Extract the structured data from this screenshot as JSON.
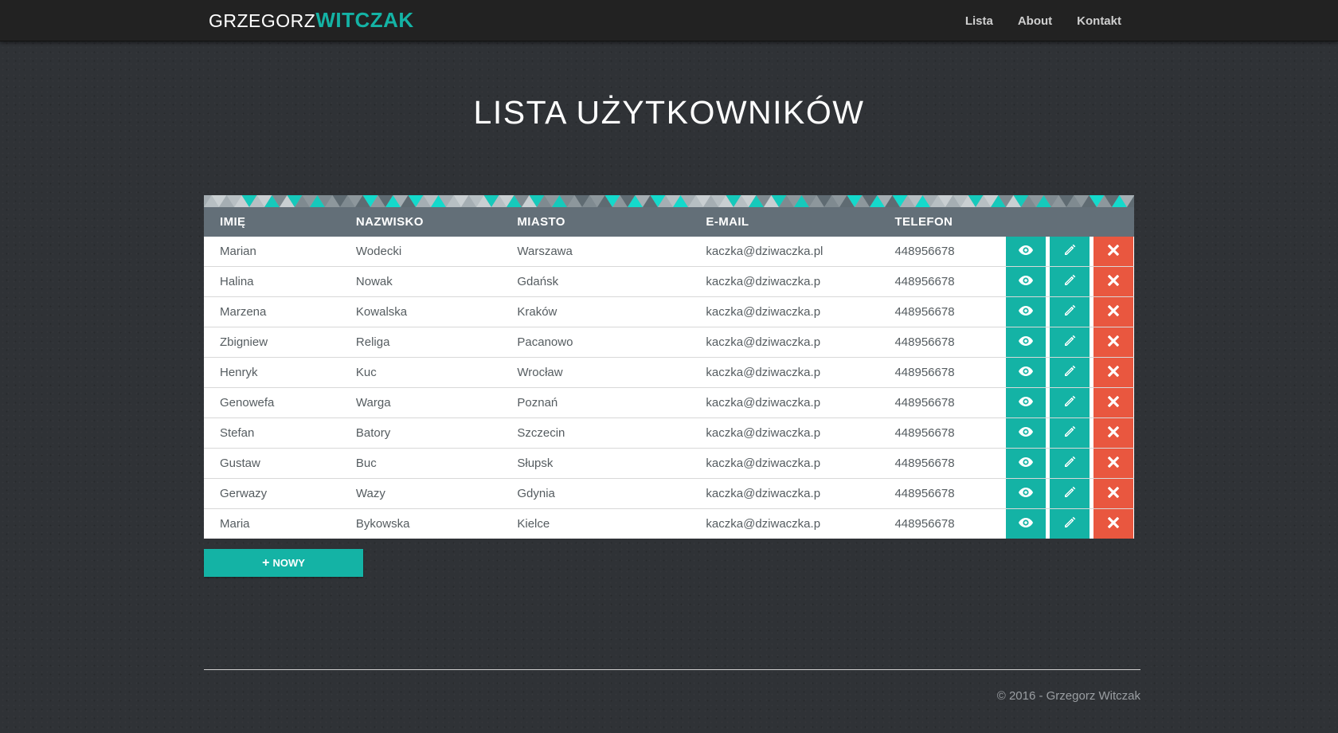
{
  "brand": {
    "first": "GRZEGORZ",
    "second": "WITCZAK",
    "accent": "#14b3a5"
  },
  "nav": [
    {
      "label": "Lista"
    },
    {
      "label": "About"
    },
    {
      "label": "Kontakt"
    }
  ],
  "page": {
    "title": "LISTA UŻYTKOWNIKÓW"
  },
  "table": {
    "columns": [
      "IMIĘ",
      "NAZWISKO",
      "MIASTO",
      "E-MAIL",
      "TELEFON"
    ],
    "rows": [
      {
        "first": "Marian",
        "last": "Wodecki",
        "city": "Warszawa",
        "email": "kaczka@dziwaczka.pl",
        "phone": "448956678"
      },
      {
        "first": "Halina",
        "last": "Nowak",
        "city": "Gdańsk",
        "email": "kaczka@dziwaczka.p",
        "phone": "448956678"
      },
      {
        "first": "Marzena",
        "last": "Kowalska",
        "city": "Kraków",
        "email": "kaczka@dziwaczka.p",
        "phone": "448956678"
      },
      {
        "first": "Zbigniew",
        "last": "Religa",
        "city": "Pacanowo",
        "email": "kaczka@dziwaczka.p",
        "phone": "448956678"
      },
      {
        "first": "Henryk",
        "last": "Kuc",
        "city": "Wrocław",
        "email": "kaczka@dziwaczka.p",
        "phone": "448956678"
      },
      {
        "first": "Genowefa",
        "last": "Warga",
        "city": "Poznań",
        "email": "kaczka@dziwaczka.p",
        "phone": "448956678"
      },
      {
        "first": "Stefan",
        "last": "Batory",
        "city": "Szczecin",
        "email": "kaczka@dziwaczka.p",
        "phone": "448956678"
      },
      {
        "first": "Gustaw",
        "last": "Buc",
        "city": "Słupsk",
        "email": "kaczka@dziwaczka.p",
        "phone": "448956678"
      },
      {
        "first": "Gerwazy",
        "last": "Wazy",
        "city": "Gdynia",
        "email": "kaczka@dziwaczka.p",
        "phone": "448956678"
      },
      {
        "first": "Maria",
        "last": "Bykowska",
        "city": "Kielce",
        "email": "kaczka@dziwaczka.p",
        "phone": "448956678"
      }
    ],
    "actions": {
      "view_icon": "eye-icon",
      "edit_icon": "pencil-icon",
      "delete_icon": "times-icon"
    },
    "colors": {
      "header_bg": "#636f78",
      "view": "#14b3a5",
      "edit": "#14b3a5",
      "delete": "#e9573f"
    }
  },
  "new_button": {
    "plus": "+",
    "label": "NOWY"
  },
  "footer": {
    "copyright": "© 2016 - Grzegorz Witczak"
  }
}
